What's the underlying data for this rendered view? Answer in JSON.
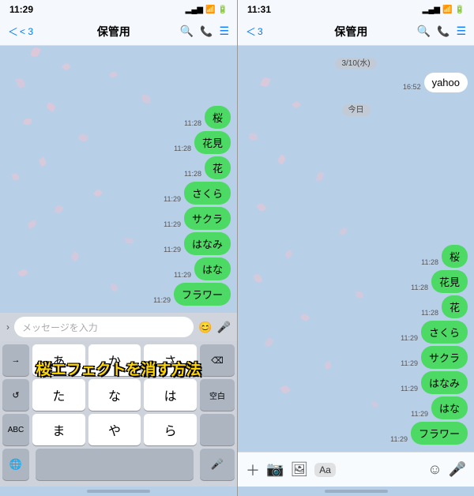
{
  "left_phone": {
    "status_time": "11:29",
    "nav_back": "< 3",
    "nav_title": "保管用",
    "messages": [
      {
        "time": "11:28",
        "text": "桜"
      },
      {
        "time": "11:28",
        "text": "花見"
      },
      {
        "time": "11:28",
        "text": "花"
      },
      {
        "time": "11:29",
        "text": "さくら"
      },
      {
        "time": "11:29",
        "text": "サクラ"
      },
      {
        "time": "11:29",
        "text": "はなみ"
      },
      {
        "time": "11:29",
        "text": "はな"
      },
      {
        "time": "11:29",
        "text": "フラワー"
      }
    ],
    "input_placeholder": "メッセージを入力",
    "keyboard": {
      "row1": [
        "あ",
        "か",
        "さ",
        "⌫"
      ],
      "row2": [
        "た",
        "な",
        "は",
        "空白"
      ],
      "row3": [
        "ABC",
        "ま",
        "や",
        "ら"
      ],
      "special_left": "→",
      "special_bottom_left": "🌐",
      "special_bottom_right": "🎤"
    }
  },
  "right_phone": {
    "status_time": "11:31",
    "nav_back": "< 3",
    "nav_title": "保管用",
    "date_badge": "3/10(水)",
    "today_badge": "今日",
    "messages_top": [
      {
        "time": "16:52",
        "text": "yahoo",
        "align": "right"
      }
    ],
    "messages": [
      {
        "time": "11:28",
        "text": "桜"
      },
      {
        "time": "11:28",
        "text": "花見"
      },
      {
        "time": "11:28",
        "text": "花"
      },
      {
        "time": "11:29",
        "text": "さくら"
      },
      {
        "time": "11:29",
        "text": "サクラ"
      },
      {
        "time": "11:29",
        "text": "はなみ"
      },
      {
        "time": "11:29",
        "text": "はな"
      },
      {
        "time": "11:29",
        "text": "フラワー"
      }
    ]
  },
  "overlay_text": "桜エフェクトを消す方法",
  "icons": {
    "search": "🔍",
    "phone": "📞",
    "menu": "☰",
    "emoji": "😊",
    "mic": "🎤",
    "plus": "+",
    "camera": "📷",
    "image": "🖼",
    "smile": "☺",
    "globe": "🌐"
  }
}
